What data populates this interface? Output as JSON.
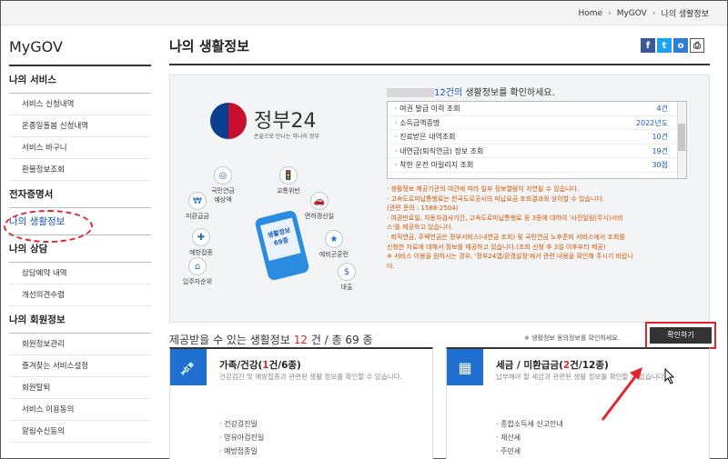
{
  "breadcrumb": [
    "Home",
    "MyGOV",
    "나의 생활정보"
  ],
  "sidebar": {
    "title": "MyGOV",
    "sections": [
      {
        "label": "나의 서비스",
        "items": [
          "서비스 신청내역",
          "온종일돌봄 신청내역",
          "서비스 바구니",
          "환불정보조회"
        ]
      },
      {
        "label": "전자증명서",
        "items": []
      },
      {
        "label": "나의 생활정보",
        "items": [],
        "active": true
      },
      {
        "label": "나의 상담",
        "items": [
          "상담예약 내역",
          "개선의견수렴"
        ]
      },
      {
        "label": "나의 회원정보",
        "items": [
          "회원정보관리",
          "즐겨찾는 서비스설정",
          "회원탈퇴",
          "서비스 이용동의",
          "알림수신동의"
        ]
      }
    ]
  },
  "page_title": "나의 생활정보",
  "share_icons": [
    "f",
    "t",
    "o",
    "print"
  ],
  "banner": {
    "logo_text": "정부24",
    "logo_sub": "손끝으로 만나는 하나의 정부",
    "icons": [
      "미환급금",
      "국민연금\n예상액",
      "교통위반",
      "면허갱신일",
      "예방접종",
      "예비군훈련",
      "입주자순위",
      "대출"
    ],
    "phone_text": "생활정보\n69종",
    "count_suffix": "12건의 생활정보를 확인하세요.",
    "count_num": "12건의",
    "list": [
      {
        "name": "· 여권 발급 이력 조회",
        "value": "4건"
      },
      {
        "name": "· 소득금액증명",
        "value": "2022년도"
      },
      {
        "name": "· 진료받은 내역조회",
        "value": "10건"
      },
      {
        "name": "· 내연금(퇴직연금) 정보 조회",
        "value": "19건"
      },
      {
        "name": "· 착한 운전 마일리지 조회",
        "value": "30점"
      }
    ],
    "notes": [
      "· 생활정보 제공기관의 여건에 따라 일부 정보열람이 지연될 수 있습니다.",
      "· 고속도로미납통행료는 한국도로공사의 미납요금 조회결과와 상이할 수 있습니다.",
      "  (관련 문의 : 1588-2504)",
      "· 여권만료일, 자동차검사기간, 고속도로미납통행료 등 3종에 대하여 '사전알림(무시)서비",
      "  스'를 제공하고 있습니다.",
      "· 퇴직연금, 주택연금은 정부서비스(내연금 조회) 및 국민연금 노후준비 서비스에서 조회를",
      "  신청한 자료에 대해서 정보를 제공하고 있습니다.(조회 신청 후 3일 이후부터 제공)",
      "※ 서비스 이용을 원하시는 경우, '정부24앱/환경설정'에서 관련 내용을 확인해 주시기 바랍니",
      "  다."
    ]
  },
  "available": {
    "prefix": "제공받을 수 있는 생활정보",
    "count": "12",
    "mid": "건 / 총",
    "total": "69",
    "suffix": "종"
  },
  "consent_text": "※ 생활정보 동의정보를 확인하세요.",
  "confirm_label": "확인하기",
  "cards": [
    {
      "title_pre": "가족/건강(",
      "title_red": "1",
      "title_post": "건/6종)",
      "desc": "건강검진 및 예방접종과 관련된 생활 정보를 확인할 수 있습니다.",
      "items": [
        "· 건강검진일",
        "· 영유아검진일",
        "· 예방접종일"
      ]
    },
    {
      "title_pre": "세금 / 미환급금(",
      "title_red": "2",
      "title_post": "건/12종)",
      "desc": "납부해야 할 세금과 관련된 생활 정보를 확인할 수 있습니다.",
      "items": [
        "· 종합소득세 신고안내",
        "· 재산세",
        "· 주민세"
      ]
    }
  ],
  "colors": {
    "accent": "#1a5ab4",
    "highlight": "#e0262c",
    "card_icon": "#1e6fcf"
  }
}
